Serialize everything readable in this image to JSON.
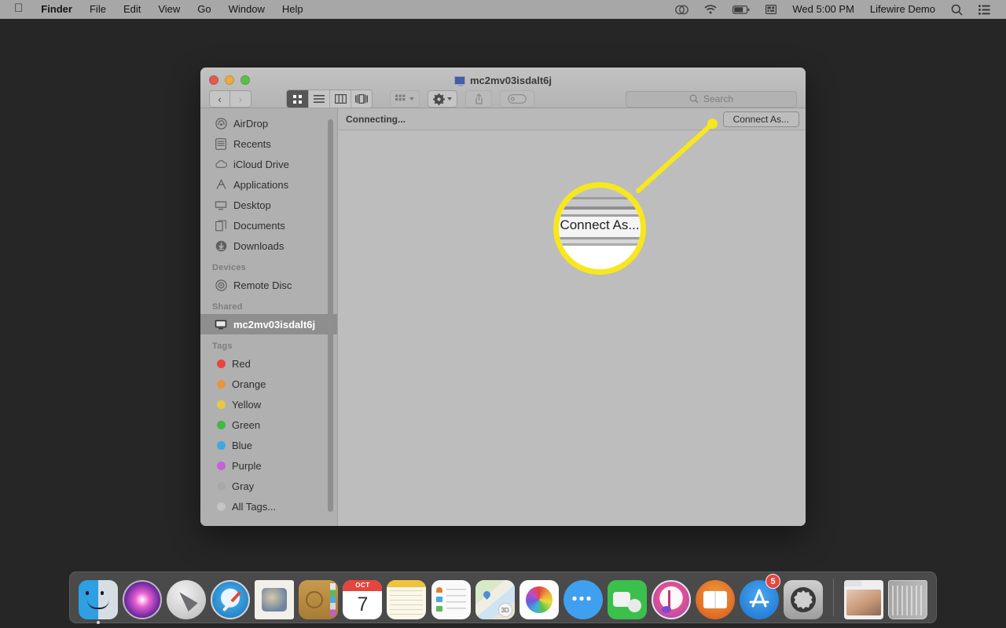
{
  "menubar": {
    "apple_icon": "apple-logo-icon",
    "left_items": [
      {
        "label": "Finder",
        "bold": true
      },
      {
        "label": "File",
        "bold": false
      },
      {
        "label": "Edit",
        "bold": false
      },
      {
        "label": "View",
        "bold": false
      },
      {
        "label": "Go",
        "bold": false
      },
      {
        "label": "Window",
        "bold": false
      },
      {
        "label": "Help",
        "bold": false
      }
    ],
    "status_icons": [
      "screen-sharing-icon",
      "wifi-icon",
      "battery-icon",
      "input-source-icon"
    ],
    "clock": "Wed 5:00 PM",
    "user": "Lifewire Demo",
    "spotlight_icon": "search-icon",
    "notification_icon": "notification-center-icon"
  },
  "window": {
    "title": "mc2mv03isdalt6j",
    "title_icon": "shared-computer-icon",
    "nav": {
      "back": "‹",
      "forward": "›"
    },
    "view_buttons": [
      {
        "name": "icon-view",
        "active": true
      },
      {
        "name": "list-view",
        "active": false
      },
      {
        "name": "column-view",
        "active": false
      },
      {
        "name": "gallery-view",
        "active": false
      }
    ],
    "arrange_button": "arrange-icon",
    "action_button": "gear-icon",
    "share_button": "share-icon",
    "tag_button": "tag-icon",
    "search": {
      "placeholder": "Search",
      "value": "",
      "icon": "search-icon"
    }
  },
  "sidebar": {
    "favorites": [
      {
        "label": "AirDrop",
        "icon": "airdrop-icon"
      },
      {
        "label": "Recents",
        "icon": "recents-icon"
      },
      {
        "label": "iCloud Drive",
        "icon": "icloud-icon"
      },
      {
        "label": "Applications",
        "icon": "applications-icon"
      },
      {
        "label": "Desktop",
        "icon": "desktop-icon"
      },
      {
        "label": "Documents",
        "icon": "documents-icon"
      },
      {
        "label": "Downloads",
        "icon": "downloads-icon"
      }
    ],
    "devices_header": "Devices",
    "devices": [
      {
        "label": "Remote Disc",
        "icon": "remote-disc-icon"
      }
    ],
    "shared_header": "Shared",
    "shared": [
      {
        "label": "mc2mv03isdalt6j",
        "icon": "shared-computer-icon",
        "selected": true
      }
    ],
    "tags_header": "Tags",
    "tags": [
      {
        "label": "Red",
        "color": "#e8453c"
      },
      {
        "label": "Orange",
        "color": "#e8953c"
      },
      {
        "label": "Yellow",
        "color": "#e8c83c"
      },
      {
        "label": "Green",
        "color": "#44b844"
      },
      {
        "label": "Blue",
        "color": "#3fa8e0"
      },
      {
        "label": "Purple",
        "color": "#c860d8"
      },
      {
        "label": "Gray",
        "color": "#a8a8a8"
      },
      {
        "label": "All Tags...",
        "color": "#c4c4c4"
      }
    ]
  },
  "content": {
    "status_text": "Connecting...",
    "connect_as_label": "Connect As..."
  },
  "callout": {
    "magnified_label": "Connect As...",
    "highlight_color": "#f8e71c"
  },
  "dock": {
    "items": [
      {
        "label": "Finder",
        "running": true
      },
      {
        "label": "Siri",
        "running": false
      },
      {
        "label": "Launchpad",
        "running": false
      },
      {
        "label": "Safari",
        "running": false
      },
      {
        "label": "Mail",
        "running": false
      },
      {
        "label": "Contacts",
        "running": false
      },
      {
        "label": "Calendar",
        "running": false,
        "month": "OCT",
        "day": "7"
      },
      {
        "label": "Notes",
        "running": false
      },
      {
        "label": "Reminders",
        "running": false
      },
      {
        "label": "Maps",
        "running": false,
        "badge_text": "3D"
      },
      {
        "label": "Photos",
        "running": false
      },
      {
        "label": "Messages",
        "running": false
      },
      {
        "label": "FaceTime",
        "running": false
      },
      {
        "label": "iTunes",
        "running": false
      },
      {
        "label": "Books",
        "running": false
      },
      {
        "label": "App Store",
        "running": false,
        "badge": "5"
      },
      {
        "label": "System Preferences",
        "running": false
      }
    ],
    "right_items": [
      {
        "label": "Downloads Folder"
      },
      {
        "label": "Trash"
      }
    ]
  }
}
